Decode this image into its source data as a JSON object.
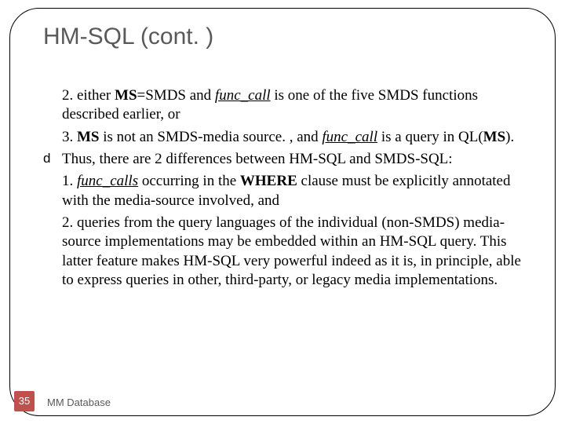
{
  "title": "HM-SQL (cont. )",
  "body": {
    "p1_a": "2. either ",
    "p1_b": "MS",
    "p1_c": "=SMDS and ",
    "p1_d": "func_call",
    "p1_e": " is one of the five SMDS functions described earlier, or",
    "p2_a": "3. ",
    "p2_b": "MS",
    "p2_c": " is not an SMDS-media source. , and ",
    "p2_d": "func_call",
    "p2_e": " is a query in QL(",
    "p2_f": "MS",
    "p2_g": ").",
    "b1": "Thus, there are 2 differences between HM-SQL and SMDS-SQL:",
    "p3_a": "1. ",
    "p3_b": "func_calls",
    "p3_c": " occurring in the ",
    "p3_d": "WHERE",
    "p3_e": " clause must be explicitly annotated with the media-source involved, and",
    "p4": "2. queries from the query languages of the individual (non-SMDS) media-source implementations may be embedded within an HM-SQL query. This latter feature makes HM-SQL very powerful indeed as it is, in principle, able to express queries in other, third-party, or legacy media implementations."
  },
  "footer": {
    "page": "35",
    "label": "MM Database"
  },
  "bullet_glyph": "d"
}
